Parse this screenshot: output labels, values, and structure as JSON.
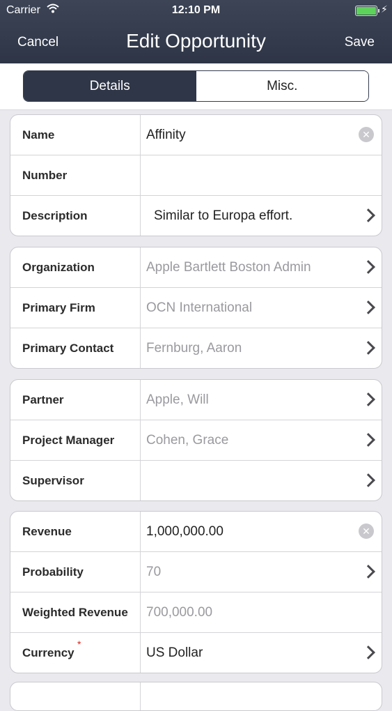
{
  "status": {
    "carrier": "Carrier",
    "time": "12:10 PM"
  },
  "nav": {
    "cancel": "Cancel",
    "title": "Edit Opportunity",
    "save": "Save"
  },
  "tabs": {
    "details": "Details",
    "misc": "Misc."
  },
  "group1": {
    "name_label": "Name",
    "name_value": "Affinity",
    "number_label": "Number",
    "description_label": "Description",
    "description_value": "Similar to Europa effort."
  },
  "group2": {
    "organization_label": "Organization",
    "organization_value": "Apple Bartlett Boston Admin",
    "primary_firm_label": "Primary Firm",
    "primary_firm_value": "OCN International",
    "primary_contact_label": "Primary Contact",
    "primary_contact_value": "Fernburg, Aaron"
  },
  "group3": {
    "partner_label": "Partner",
    "partner_value": "Apple, Will",
    "project_manager_label": "Project Manager",
    "project_manager_value": "Cohen, Grace",
    "supervisor_label": "Supervisor"
  },
  "group4": {
    "revenue_label": "Revenue",
    "revenue_value": "1,000,000.00",
    "probability_label": "Probability",
    "probability_value": "70",
    "weighted_revenue_label": "Weighted Revenue",
    "weighted_revenue_value": "700,000.00",
    "currency_label": "Currency",
    "currency_required": "*",
    "currency_value": "US Dollar"
  },
  "colors": {
    "navbar": "#2e3546",
    "active_tab": "#2f3647",
    "required": "#d9251d",
    "battery": "#5ed35b"
  }
}
